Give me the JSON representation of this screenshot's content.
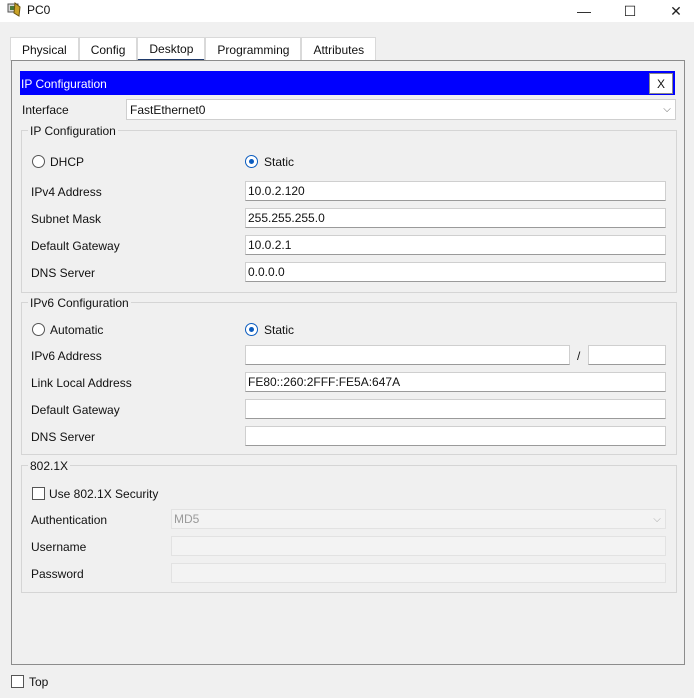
{
  "window": {
    "title": "PC0",
    "min_glyph": "—",
    "max_glyph": "☐",
    "close_glyph": "✕",
    "icon": "pc-icon"
  },
  "tabs": [
    {
      "label": "Physical",
      "active": false
    },
    {
      "label": "Config",
      "active": false
    },
    {
      "label": "Desktop",
      "active": true
    },
    {
      "label": "Programming",
      "active": false
    },
    {
      "label": "Attributes",
      "active": false
    }
  ],
  "panel": {
    "title": "IP Configuration",
    "close_label": "X",
    "header_color": "#0000ff"
  },
  "interface": {
    "label": "Interface",
    "value": "FastEthernet0"
  },
  "ipv4": {
    "legend": "IP Configuration",
    "dhcp_label": "DHCP",
    "static_label": "Static",
    "selected": "Static",
    "ipv4_label": "IPv4 Address",
    "ipv4_value": "10.0.2.120",
    "mask_label": "Subnet Mask",
    "mask_value": "255.255.255.0",
    "gw_label": "Default Gateway",
    "gw_value": "10.0.2.1",
    "dns_label": "DNS Server",
    "dns_value": "0.0.0.0"
  },
  "ipv6": {
    "legend": "IPv6 Configuration",
    "auto_label": "Automatic",
    "static_label": "Static",
    "selected": "Static",
    "addr_label": "IPv6 Address",
    "addr_value": "",
    "slash": "/",
    "prefix_value": "",
    "ll_label": "Link Local Address",
    "ll_value": "FE80::260:2FFF:FE5A:647A",
    "gw_label": "Default Gateway",
    "gw_value": "",
    "dns_label": "DNS Server",
    "dns_value": ""
  },
  "dot1x": {
    "legend": "802.1X",
    "use_label": "Use 802.1X Security",
    "use_checked": false,
    "auth_label": "Authentication",
    "auth_value": "MD5",
    "user_label": "Username",
    "user_value": "",
    "pass_label": "Password",
    "pass_value": ""
  },
  "footer": {
    "top_label": "Top",
    "top_checked": false
  }
}
